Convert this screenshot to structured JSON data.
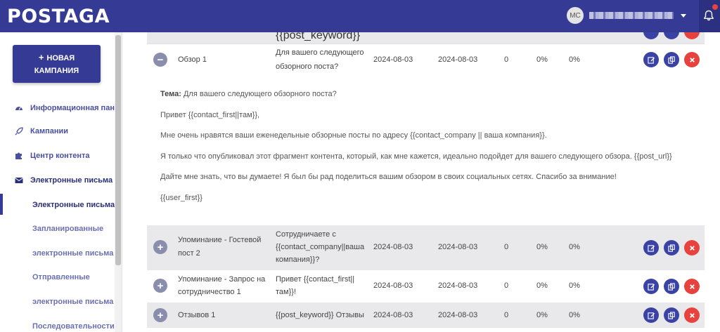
{
  "app": {
    "logo": "POSTAGA"
  },
  "user": {
    "initials": "MC"
  },
  "sidebar": {
    "new_campaign": {
      "plus": "+",
      "line1": "НОВАЯ",
      "line2": "КАМПАНИЯ"
    },
    "items": [
      {
        "label": "Информационная панель",
        "icon": "dashboard-icon"
      },
      {
        "label": "Кампании",
        "icon": "rocket-icon"
      },
      {
        "label": "Центр контента",
        "icon": "puzzle-icon"
      },
      {
        "label": "Электронные письма",
        "icon": "envelope-icon"
      }
    ],
    "sub_items": [
      {
        "label": "Электронные письма"
      },
      {
        "label": "Запланированные"
      },
      {
        "label": "электронные письма"
      },
      {
        "label": "Отправленные"
      },
      {
        "label": "электронные письма"
      },
      {
        "label": "Последовательности"
      }
    ]
  },
  "table": {
    "top_partial": {
      "subject": "{{post_keyword}}"
    },
    "expanded_row": {
      "toggle": "−",
      "name": "Обзор 1",
      "subject_line1": "Для вашего следующего",
      "subject_line2": "обзорного поста?",
      "date1": "2024-08-03",
      "date2": "2024-08-03",
      "count": "0",
      "pct1": "0%",
      "pct2": "0%"
    },
    "detail": {
      "topic_label": "Тема:",
      "topic_text": " Для вашего следующего обзорного поста?",
      "lines": [
        "Привет {{contact_first||там}},",
        "Мне очень нравятся ваши еженедельные обзорные посты по адресу {{contact_company || ваша компания}}.",
        "Я только что опубликовал этот фрагмент контента, который, как мне кажется, идеально подойдет для вашего следующего обзора. {{post_url}}",
        "Дайте мне знать, что вы думаете! Я был бы рад поделиться вашим обзором в своих социальных сетях. Спасибо за внимание!",
        "{{user_first}}"
      ]
    },
    "rows": [
      {
        "toggle": "+",
        "name_line1": "Упоминание - Гостевой",
        "name_line2": "пост 2",
        "subject_line1": "Сотрудничаете с",
        "subject_line2": "{{contact_company||ваша",
        "subject_line3": "компания}}?",
        "date1": "2024-08-03",
        "date2": "2024-08-03",
        "count": "0",
        "pct1": "0%",
        "pct2": "0%"
      },
      {
        "toggle": "+",
        "name_line1": "Упоминание - Запрос на",
        "name_line2": "сотрудничество 1",
        "subject_line1": "Привет {{contact_first||",
        "subject_line2": "там}}!",
        "date1": "2024-08-03",
        "date2": "2024-08-03",
        "count": "0",
        "pct1": "0%",
        "pct2": "0%"
      },
      {
        "toggle": "+",
        "name_line1": "Отзывов 1",
        "subject_line1": "{{post_keyword}} Отзывы",
        "date1": "2024-08-03",
        "date2": "2024-08-03",
        "count": "0",
        "pct1": "0%",
        "pct2": "0%"
      }
    ]
  },
  "colors": {
    "brand": "#353a95",
    "action_blue": "#3a43a3",
    "delete_red": "#e8423e",
    "row_gray": "#e9e9ec"
  }
}
